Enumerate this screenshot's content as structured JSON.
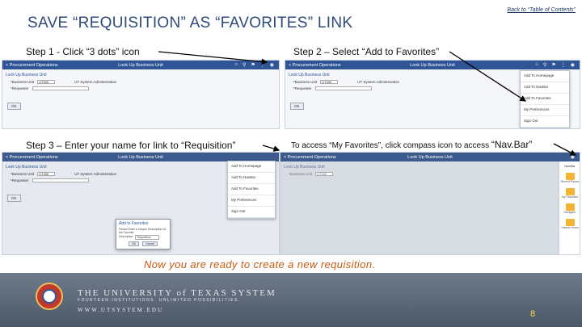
{
  "header": {
    "title": "SAVE “REQUISITION” AS “FAVORITES” LINK",
    "back_link": "Back to “Table of Contents”"
  },
  "steps": {
    "step1": "Step 1 - Click “3 dots” icon",
    "step2": "Step 2 – Select “Add to Favorites”",
    "step3": "Step 3 – Enter your name for link to “Requisition”",
    "step4_a": "To access “My Favorites”, click compass icon to access ",
    "step4_b": "“Nav.Bar”"
  },
  "app": {
    "left_title": "< Procurement Operations",
    "center_title": "Look Up Business Unit",
    "subheader": "Look Up Business Unit",
    "field_business_unit_label": "*Business Unit",
    "field_business_unit_value": "UT000",
    "field_description": "UT System Administration",
    "field_requester_label": "*Requester",
    "ok_button": "OK"
  },
  "menu_items": [
    "Add To Homepage",
    "Add To NavBar",
    "Add To Favorites",
    "My Preferences",
    "Sign Out"
  ],
  "dialog": {
    "title": "Add to Favorites",
    "body": "Please Enter a Unique Description for the Favorite",
    "field_label": "Description",
    "field_value": "Requisition",
    "ok": "OK",
    "cancel": "Cancel"
  },
  "navbar": {
    "title": "NavBar",
    "tiles": [
      "Recent Places",
      "My Favorites",
      "Navigator",
      "Classic Home"
    ]
  },
  "footer": {
    "ready_text": "Now you are ready to create a new requisition.",
    "university": "THE UNIVERSITY of TEXAS SYSTEM",
    "tagline": "FOURTEEN INSTITUTIONS. UNLIMITED POSSIBILITIES.",
    "url": "WWW.UTSYSTEM.EDU",
    "page_number": "8"
  },
  "colors": {
    "accent_blue": "#2f5597",
    "title_blue": "#2e4a7a",
    "ready_orange": "#c55a11",
    "page_number_yellow": "#ffd84a"
  }
}
